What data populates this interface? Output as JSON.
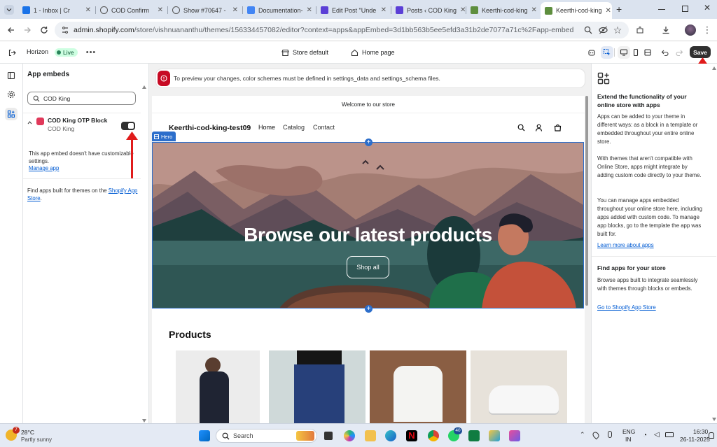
{
  "browser": {
    "tabs": [
      {
        "title": "1 - Inbox | Cr",
        "color": "#1a73e8"
      },
      {
        "title": "COD Confirm",
        "color": "#666666"
      },
      {
        "title": "Show #70647 - ",
        "color": "#666666"
      },
      {
        "title": "Documentation-",
        "color": "#4285f4"
      },
      {
        "title": "Edit Post \"Unde",
        "color": "#5b3fd6"
      },
      {
        "title": "Posts ‹ COD King",
        "color": "#5b3fd6"
      },
      {
        "title": "Keerthi-cod-king",
        "color": "#5e8e3e"
      },
      {
        "title": "Keerthi-cod-king",
        "color": "#5e8e3e"
      }
    ],
    "url_host": "admin.shopify.com",
    "url_path": "/store/vishnuananthu/themes/156334457082/editor?context=apps&appEmbed=3d1bb563b5ee5efd3a31b2de7077a71c%2Fapp-embed"
  },
  "editor": {
    "theme_name": "Horizon",
    "live_badge": "Live",
    "store_selector": "Store default",
    "page_selector": "Home page",
    "save_label": "Save"
  },
  "left_panel": {
    "title": "App embeds",
    "search_value": "COD King",
    "embed": {
      "name": "COD King OTP Block",
      "app": "COD King",
      "enabled": true,
      "note": "This app embed doesn't have customizable settings.",
      "manage_link": "Manage app"
    },
    "footer_text": "Find apps built for themes on the",
    "footer_link_1": "Shopify",
    "footer_link_2": "App Store",
    "footer_end": "."
  },
  "preview": {
    "notice": "To preview your changes, color schemes must be defined in settings_data and settings_schema files.",
    "announcement": "Welcome to our store",
    "store_name": "Keerthi-cod-king-test09",
    "nav": [
      "Home",
      "Catalog",
      "Contact"
    ],
    "section_tag": "Hero",
    "hero_title": "Browse our latest products",
    "hero_button": "Shop all",
    "products_heading": "Products"
  },
  "right_panel": {
    "title": "Extend the functionality of your online store with apps",
    "p1": "Apps can be added to your theme in different ways: as a block in a template or embedded throughout your entire online store.",
    "p2": "With themes that aren't compatible with Online Store, apps might integrate by adding custom code directly to your theme.",
    "p3": "You can manage apps embedded throughout your online store here, including apps added with custom code. To manage app blocks, go to the template the app was built for.",
    "link1": "Learn more about apps",
    "title2": "Find apps for your store",
    "p4": "Browse apps built to integrate seamlessly with themes through blocks or embeds.",
    "link2": "Go to Shopify App Store"
  },
  "taskbar": {
    "temp": "28°C",
    "weather": "Partly sunny",
    "search_placeholder": "Search",
    "lang1": "ENG",
    "lang2": "IN",
    "time": "16:30",
    "date": "26-11-2025",
    "weather_badge": "7",
    "whatsapp_badge": "40"
  },
  "colors": {
    "accent": "#005bd3",
    "selection": "#2c6ecb",
    "annotation": "#e01b1b",
    "dark_button": "#303030"
  }
}
